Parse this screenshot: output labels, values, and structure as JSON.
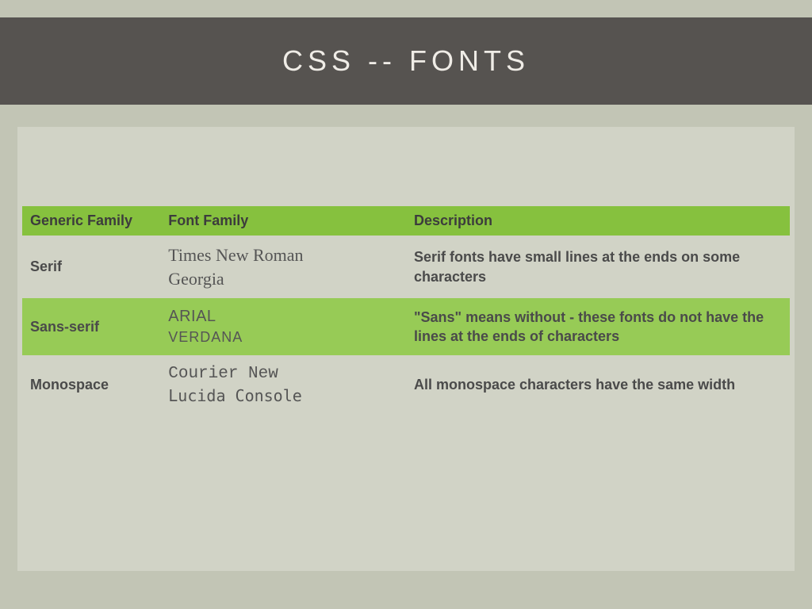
{
  "title": "CSS -- FONTS",
  "table": {
    "headers": {
      "generic": "Generic family",
      "font": "Font family",
      "desc": "Description"
    },
    "rows": [
      {
        "generic": "Serif",
        "font1": "Times New Roman",
        "font2": "Georgia",
        "desc": "Serif fonts have small lines at the ends on some characters"
      },
      {
        "generic": "Sans-serif",
        "font1": "Arial",
        "font2": "Verdana",
        "desc": "\"Sans\" means without - these fonts do not have the lines at the ends of characters"
      },
      {
        "generic": "Monospace",
        "font1": "Courier New",
        "font2": "Lucida Console",
        "desc": "All monospace characters have the same width"
      }
    ]
  }
}
